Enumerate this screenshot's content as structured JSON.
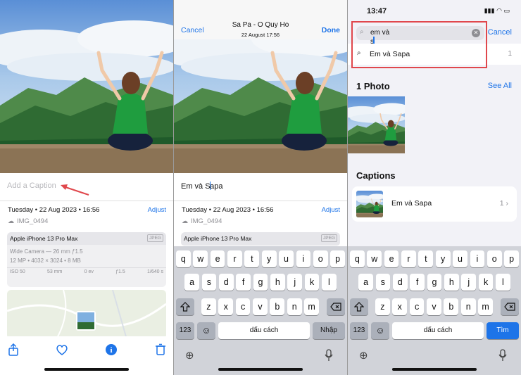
{
  "panel1": {
    "caption_placeholder": "Add a Caption",
    "date_time": "Tuesday • 22 Aug 2023 • 16:56",
    "adjust_label": "Adjust",
    "file_name": "IMG_0494",
    "device": "Apple iPhone 13 Pro Max",
    "format_badge": "JPEG",
    "camera": "Wide Camera — 26 mm ƒ1.5",
    "specs": "12 MP • 4032 × 3024 • 8 MB",
    "exif": [
      "ISO 50",
      "53 mm",
      "0 ev",
      "ƒ1.5",
      "1/640 s"
    ],
    "toolbar": [
      "share-icon",
      "heart-icon",
      "info-icon",
      "trash-icon"
    ]
  },
  "panel2": {
    "cancel_label": "Cancel",
    "title": "Sa Pa - O Quy Ho",
    "subtitle": "22 August  17:56",
    "done_label": "Done",
    "caption_before_caret": "Em và S",
    "caption_after_caret": "apa",
    "date_time": "Tuesday • 22 Aug 2023 • 16:56",
    "adjust_label": "Adjust",
    "file_name": "IMG_0494",
    "device": "Apple iPhone 13 Pro Max",
    "format_badge": "JPEG"
  },
  "panel3": {
    "status_time": "13:47",
    "search_query": "em và s",
    "cancel_label": "Cancel",
    "suggestion_text": "Em và Sapa",
    "suggestion_count": "1",
    "photos_title": "1 Photo",
    "see_all_label": "See All",
    "captions_title": "Captions",
    "caption_result": "Em và Sapa",
    "caption_result_count": "1"
  },
  "keyboard": {
    "row1": [
      "q",
      "w",
      "e",
      "r",
      "t",
      "y",
      "u",
      "i",
      "o",
      "p"
    ],
    "row2": [
      "a",
      "s",
      "d",
      "f",
      "g",
      "h",
      "j",
      "k",
      "l"
    ],
    "row3": [
      "z",
      "x",
      "c",
      "v",
      "b",
      "n",
      "m"
    ],
    "num_label": "123",
    "space_label": "dấu cách",
    "return_label_p2": "Nhập",
    "return_label_p3": "Tìm"
  },
  "colors": {
    "accent": "#1e74e8",
    "highlight_box": "#e0474c",
    "annotation_arrow": "#e0474c"
  }
}
